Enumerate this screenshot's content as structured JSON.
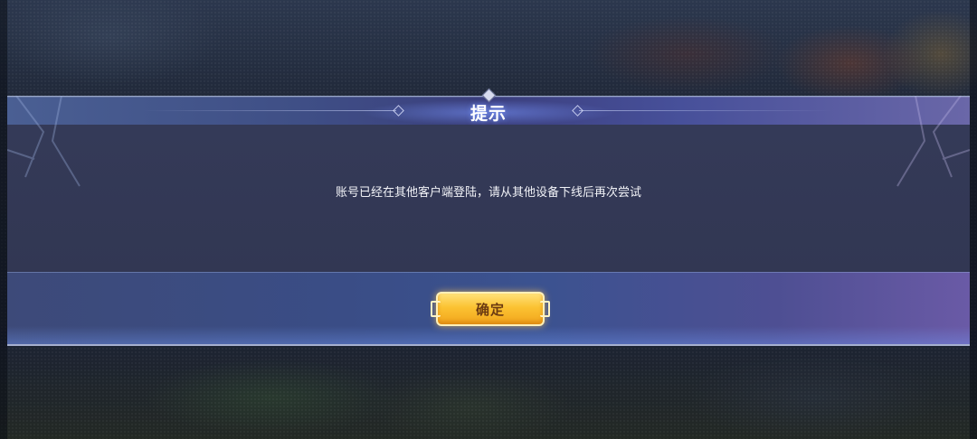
{
  "dialog": {
    "title": "提示",
    "message": "账号已经在其他客户端登陆，请从其他设备下线后再次尝试",
    "confirm_label": "确定"
  },
  "colors": {
    "button_gold": "#fbc232",
    "button_text": "#6b3a12",
    "title_bar": "#3f4f86",
    "panel": "#343a58"
  }
}
